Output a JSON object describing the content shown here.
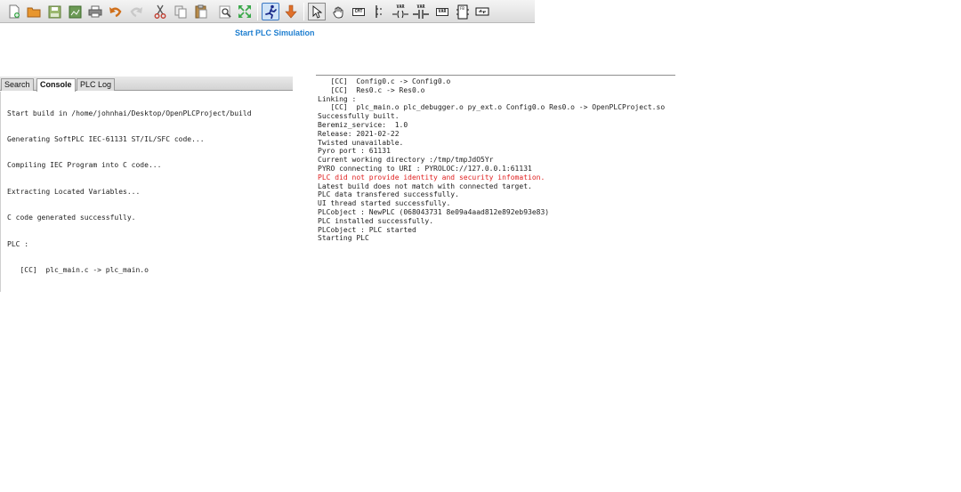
{
  "toolbar": {
    "buttons": [
      {
        "id": "new",
        "icon": "new-file-icon"
      },
      {
        "id": "open",
        "icon": "open-folder-icon"
      },
      {
        "id": "save",
        "icon": "save-icon"
      },
      {
        "id": "save-as",
        "icon": "save-as-icon"
      },
      {
        "id": "print",
        "icon": "print-icon"
      },
      {
        "id": "undo",
        "icon": "undo-icon"
      },
      {
        "id": "redo",
        "icon": "redo-icon"
      },
      {
        "id": "cut",
        "icon": "cut-icon"
      },
      {
        "id": "copy",
        "icon": "copy-icon"
      },
      {
        "id": "paste",
        "icon": "paste-icon"
      },
      {
        "id": "find",
        "icon": "find-icon"
      },
      {
        "id": "fullscreen",
        "icon": "fullscreen-icon"
      },
      {
        "id": "start-simulation",
        "icon": "running-man-icon"
      },
      {
        "id": "transfer",
        "icon": "down-arrow-icon"
      },
      {
        "id": "select",
        "icon": "pointer-icon"
      },
      {
        "id": "move-view",
        "icon": "hand-icon"
      },
      {
        "id": "add-comment",
        "icon": "comment-icon",
        "label": "CMT"
      },
      {
        "id": "add-power-rail",
        "icon": "power-rail-icon"
      },
      {
        "id": "add-coil",
        "icon": "coil-icon",
        "label": "VAR"
      },
      {
        "id": "add-contact",
        "icon": "contact-icon",
        "label": "VAR"
      },
      {
        "id": "add-variable",
        "icon": "variable-icon",
        "label": "VAR"
      },
      {
        "id": "add-block",
        "icon": "function-block-icon",
        "label": "FB"
      },
      {
        "id": "add-connection",
        "icon": "connection-icon"
      }
    ],
    "tooltip": "Start PLC Simulation"
  },
  "left_panel": {
    "tabs": [
      {
        "label": "Search",
        "active": false
      },
      {
        "label": "Console",
        "active": true
      },
      {
        "label": "PLC Log",
        "active": false
      }
    ],
    "console_lines": [
      "Start build in /home/johnhai/Desktop/OpenPLCProject/build",
      "Generating SoftPLC IEC-61131 ST/IL/SFC code...",
      "Compiling IEC Program into C code...",
      "Extracting Located Variables...",
      "C code generated successfully.",
      "PLC :",
      "   [CC]  plc_main.c -> plc_main.o"
    ]
  },
  "right_panel": {
    "log_lines": [
      {
        "text": "   [CC]  Config0.c -> Config0.o",
        "error": false
      },
      {
        "text": "   [CC]  Res0.c -> Res0.o",
        "error": false
      },
      {
        "text": "Linking :",
        "error": false
      },
      {
        "text": "   [CC]  plc_main.o plc_debugger.o py_ext.o Config0.o Res0.o -> OpenPLCProject.so",
        "error": false
      },
      {
        "text": "Successfully built.",
        "error": false
      },
      {
        "text": "Beremiz_service:  1.0",
        "error": false
      },
      {
        "text": "Release: 2021-02-22",
        "error": false
      },
      {
        "text": "Twisted unavailable.",
        "error": false
      },
      {
        "text": "Pyro port : 61131",
        "error": false
      },
      {
        "text": "Current working directory :/tmp/tmpJdO5Yr",
        "error": false
      },
      {
        "text": "PYRO connecting to URI : PYROLOC://127.0.0.1:61131",
        "error": false
      },
      {
        "text": "PLC did not provide identity and security infomation.",
        "error": true
      },
      {
        "text": "Latest build does not match with connected target.",
        "error": false
      },
      {
        "text": "PLC data transfered successfully.",
        "error": false
      },
      {
        "text": "UI thread started successfully.",
        "error": false
      },
      {
        "text": "PLCobject : NewPLC (068043731 8e09a4aad812e892eb93e83)",
        "error": false
      },
      {
        "text": "PLC installed successfully.",
        "error": false
      },
      {
        "text": "PLCobject : PLC started",
        "error": false
      },
      {
        "text": "Starting PLC",
        "error": false
      }
    ]
  },
  "colors": {
    "tooltip": "#1f7fd0",
    "error_text": "#e02020",
    "selected_tool": "#cfe3f7"
  }
}
